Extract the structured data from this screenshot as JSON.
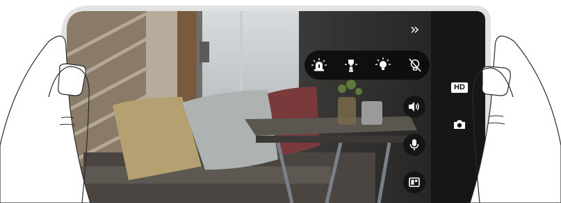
{
  "colors": {
    "frame": "#e2e2e2",
    "overlay_bg": "#141414",
    "icon": "#ffffff"
  },
  "side_panel": {
    "hd_label": "HD"
  },
  "icons": {
    "expand": "double-chevron-right-icon",
    "siren": "siren-icon",
    "spotlight": "spotlight-icon",
    "bulb": "bulb-icon",
    "bulb_off": "bulb-off-icon",
    "speaker": "speaker-icon",
    "mic": "microphone-icon",
    "layout": "layout-icon",
    "snapshot": "camera-icon"
  }
}
